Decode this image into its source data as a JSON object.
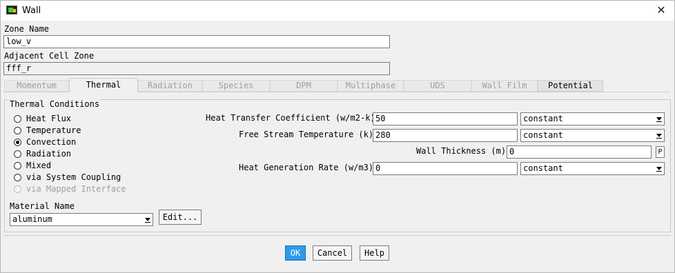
{
  "window": {
    "title": "Wall",
    "close_glyph": "✕"
  },
  "zone": {
    "zone_name_label": "Zone Name",
    "zone_name_value": "low_v",
    "adjacent_label": "Adjacent Cell Zone",
    "adjacent_value": "fff_r"
  },
  "tabs": [
    {
      "label": "Momentum",
      "state": "disabled"
    },
    {
      "label": "Thermal",
      "state": "active"
    },
    {
      "label": "Radiation",
      "state": "disabled"
    },
    {
      "label": "Species",
      "state": "disabled"
    },
    {
      "label": "DPM",
      "state": "disabled"
    },
    {
      "label": "Multiphase",
      "state": "disabled"
    },
    {
      "label": "UDS",
      "state": "disabled"
    },
    {
      "label": "Wall Film",
      "state": "disabled"
    },
    {
      "label": "Potential",
      "state": "enabled"
    }
  ],
  "thermal": {
    "group_title": "Thermal Conditions",
    "options": [
      {
        "label": "Heat Flux",
        "checked": false,
        "disabled": false
      },
      {
        "label": "Temperature",
        "checked": false,
        "disabled": false
      },
      {
        "label": "Convection",
        "checked": true,
        "disabled": false
      },
      {
        "label": "Radiation",
        "checked": false,
        "disabled": false
      },
      {
        "label": "Mixed",
        "checked": false,
        "disabled": false
      },
      {
        "label": "via System Coupling",
        "checked": false,
        "disabled": false
      },
      {
        "label": "via Mapped Interface",
        "checked": false,
        "disabled": true
      }
    ],
    "material_label": "Material Name",
    "material_value": "aluminum",
    "edit_button": "Edit...",
    "htc_label": "Heat Transfer Coefficient (w/m2-k)",
    "htc_value": "50",
    "htc_method": "constant",
    "fst_label": "Free Stream Temperature (k)",
    "fst_value": "280",
    "fst_method": "constant",
    "wt_label": "Wall Thickness (m)",
    "wt_value": "0",
    "wt_param": "P",
    "hgr_label": "Heat Generation Rate (w/m3)",
    "hgr_value": "0",
    "hgr_method": "constant"
  },
  "footer": {
    "ok": "OK",
    "cancel": "Cancel",
    "help": "Help"
  }
}
